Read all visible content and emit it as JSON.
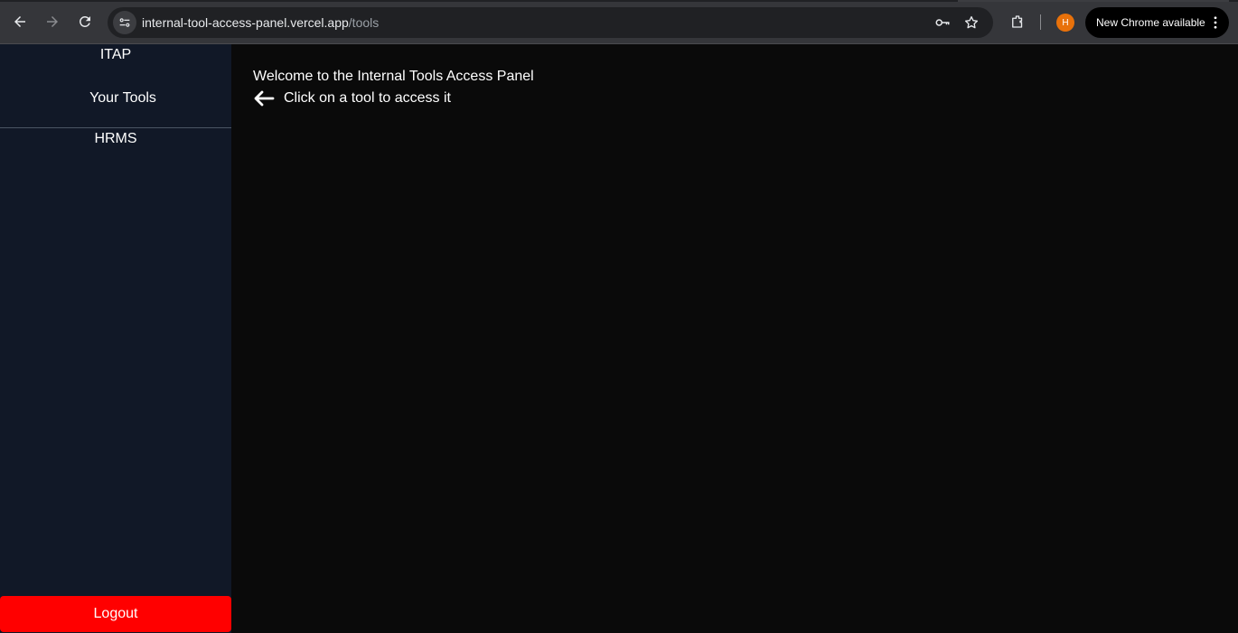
{
  "browser": {
    "url_host": "internal-tool-access-panel.vercel.app",
    "url_path": "/tools",
    "profile_initial": "H",
    "update_label": "New Chrome available",
    "icons": [
      "back-arrow-icon",
      "forward-arrow-icon",
      "reload-icon",
      "site-info-icon",
      "key-icon",
      "star-icon",
      "extensions-icon",
      "more-vert-icon"
    ]
  },
  "sidebar": {
    "brand": "ITAP",
    "section_label": "Your Tools",
    "tools": [
      {
        "label": "HRMS"
      }
    ],
    "logout_label": "Logout",
    "logout_color": "#ff0000",
    "background": "#111827"
  },
  "main": {
    "welcome": "Welcome to the Internal Tools Access Panel",
    "hint": "Click on a tool to access it",
    "hint_icon": "left-arrow-icon",
    "background": "#0a0a0a"
  }
}
